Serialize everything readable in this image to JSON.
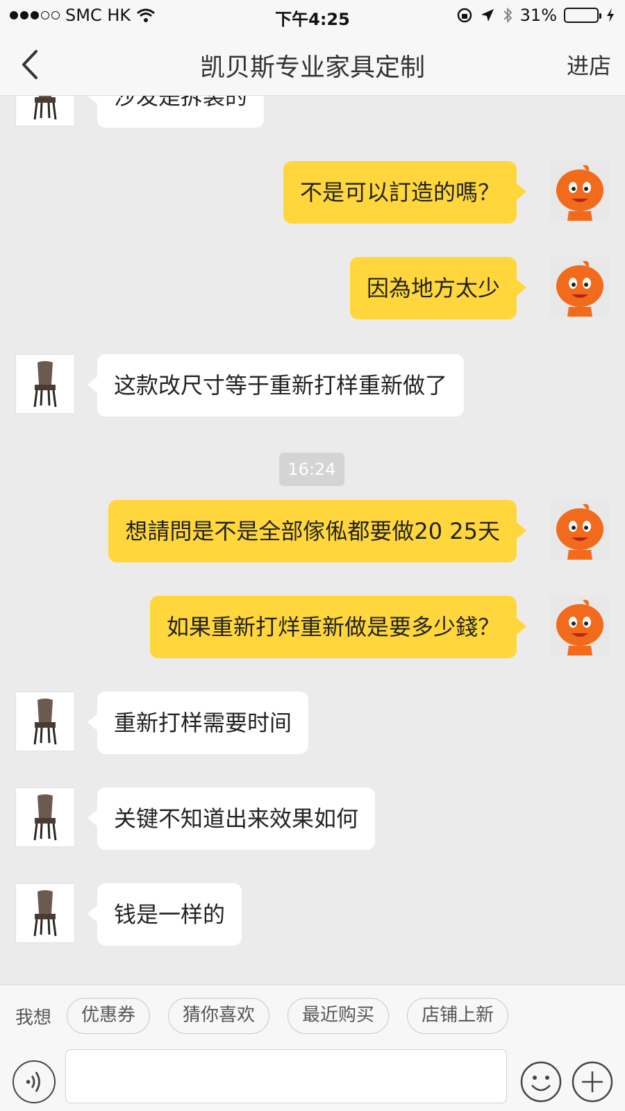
{
  "status_bar": {
    "carrier": "SMC HK",
    "time": "下午4:25",
    "battery": "31%",
    "battery_level": 0.31
  },
  "nav": {
    "title": "凯贝斯专业家具定制",
    "store_label": "进店"
  },
  "messages": [
    {
      "side": "in",
      "text": "沙发是拆装的"
    },
    {
      "side": "out",
      "text": "不是可以訂造的嗎？"
    },
    {
      "side": "out",
      "text": "因為地方太少"
    },
    {
      "side": "in",
      "text": "这款改尺寸等于重新打样重新做了"
    },
    {
      "side": "out",
      "text": "想請問是不是全部傢俬都要做20 25天"
    },
    {
      "side": "out",
      "text": "如果重新打烊重新做是要多少錢？"
    },
    {
      "side": "in",
      "text": "重新打样需要时间"
    },
    {
      "side": "in",
      "text": "关键不知道出来效果如何"
    },
    {
      "side": "in",
      "text": "钱是一样的"
    }
  ],
  "timestamp": "16:24",
  "quick_replies": {
    "label": "我想",
    "items": [
      "优惠券",
      "猜你喜欢",
      "最近购买",
      "店铺上新"
    ]
  },
  "input": {
    "placeholder": "",
    "value": ""
  },
  "icons": {
    "voice": "voice-icon",
    "emoji": "emoji-icon",
    "plus": "plus-icon",
    "back": "back-chevron-icon"
  },
  "colors": {
    "outgoing_bubble": "#ffd73c",
    "incoming_bubble": "#ffffff",
    "background": "#ebebeb"
  }
}
